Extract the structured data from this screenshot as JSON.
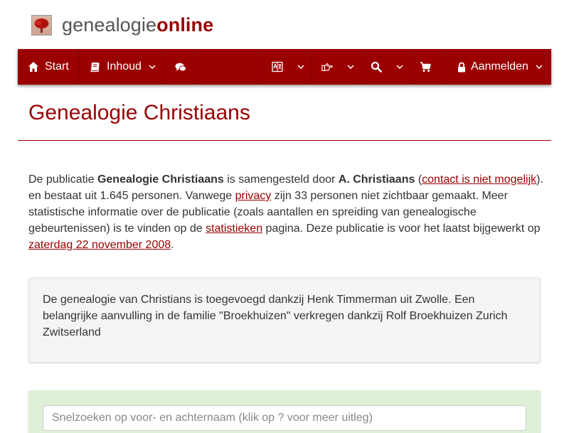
{
  "site": {
    "name_part1": "genealogie",
    "name_part2": "online"
  },
  "nav": {
    "start": "Start",
    "inhoud": "Inhoud",
    "aanmelden": "Aanmelden"
  },
  "page": {
    "title": "Genealogie Christiaans"
  },
  "intro": {
    "t1": "De publicatie ",
    "pub_name": "Genealogie Christiaans",
    "t2": " is samengesteld door ",
    "author": "A. Christiaans",
    "t3": " (",
    "contact_link": "contact is niet mogelijk",
    "t4": "). en bestaat uit 1.645 personen. Vanwege ",
    "privacy_link": "privacy",
    "t5": " zijn 33 personen niet zichtbaar gemaakt. Meer statistische informatie over de publicatie (zoals aantallen en spreiding van genealogische gebeurtenissen) is te vinden op de ",
    "stats_link": "statistieken",
    "t6": " pagina. Deze publicatie is voor het laatst bijgewerkt op ",
    "date_link": "zaterdag 22 november 2008",
    "t7": "."
  },
  "note": "De genealogie van Christians is toegevoegd dankzij Henk Timmerman uit Zwolle. Een belangrijke aanvulling in de familie \"Broekhuizen\" verkregen dankzij Rolf Broekhuizen Zurich Zwitserland",
  "search": {
    "placeholder": "Snelzoeken op voor- en achternaam (klik op ? voor meer uitleg)",
    "value": ""
  },
  "colors": {
    "brand": "#990000",
    "navbar": "#9b0000",
    "search_panel": "#dff0d8"
  },
  "icons": [
    "tree-logo-icon",
    "home-icon",
    "book-icon",
    "chat-icon",
    "language-icon",
    "hand-point-icon",
    "search-icon",
    "cart-icon",
    "lock-icon",
    "chevron-down-icon"
  ]
}
